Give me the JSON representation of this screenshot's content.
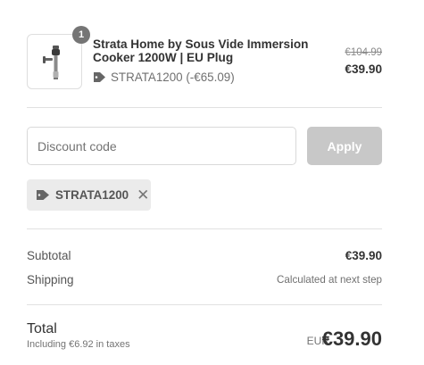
{
  "product": {
    "quantity": "1",
    "title": "Strata Home by Sous Vide Immersion Cooker 1200W | EU Plug",
    "discount_line": "STRATA1200 (-€65.09)",
    "price_old": "€104.99",
    "price_new": "€39.90",
    "thumbnail_icon": "immersion-cooker-image"
  },
  "discount_form": {
    "placeholder": "Discount code",
    "apply_label": "Apply"
  },
  "applied_code": {
    "code": "STRATA1200",
    "remove_glyph": "✕"
  },
  "summary": {
    "subtotal_label": "Subtotal",
    "subtotal_value": "€39.90",
    "shipping_label": "Shipping",
    "shipping_value": "Calculated at next step"
  },
  "total": {
    "label": "Total",
    "tax_note": "Including €6.92 in taxes",
    "currency": "EUR",
    "amount": "€39.90"
  },
  "colors": {
    "text": "#333333",
    "muted": "#707070",
    "apply_disabled": "#c8c8c8",
    "chip_bg": "#ebebeb",
    "badge_bg": "#757575"
  }
}
